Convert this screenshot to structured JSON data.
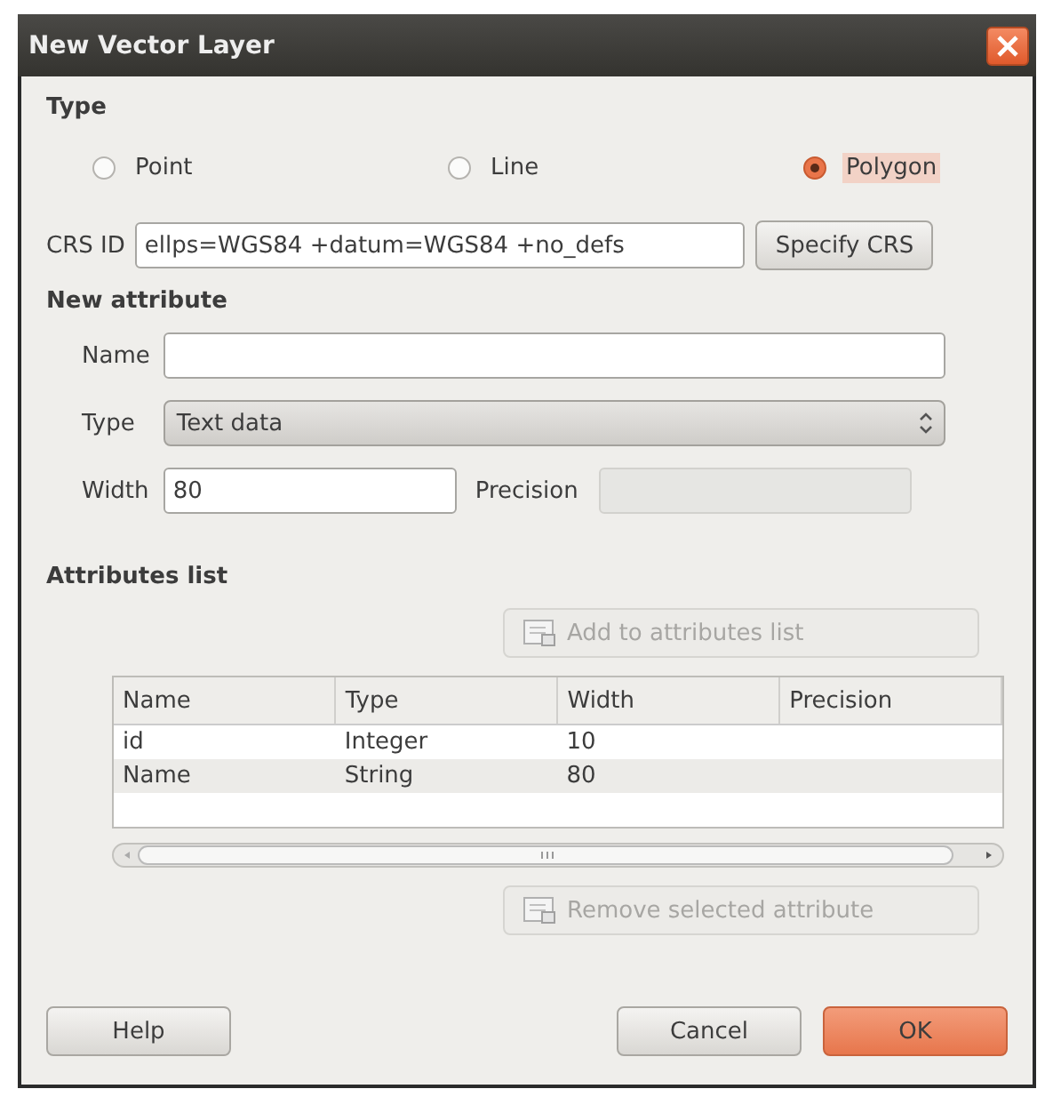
{
  "window": {
    "title": "New Vector Layer"
  },
  "type_section": {
    "heading": "Type",
    "options": [
      {
        "label": "Point",
        "selected": false
      },
      {
        "label": "Line",
        "selected": false
      },
      {
        "label": "Polygon",
        "selected": true
      }
    ]
  },
  "crs": {
    "label": "CRS ID",
    "value": "ellps=WGS84 +datum=WGS84 +no_defs",
    "button": "Specify CRS"
  },
  "new_attribute": {
    "heading": "New attribute",
    "name_label": "Name",
    "type_label": "Type",
    "type_value": "Text data",
    "width_label": "Width",
    "width_value": "80",
    "precision_label": "Precision",
    "precision_disabled": true
  },
  "attributes_list": {
    "heading": "Attributes list",
    "add_button": {
      "label": "Add to attributes list",
      "disabled": true
    },
    "columns": [
      "Name",
      "Type",
      "Width",
      "Precision"
    ],
    "rows": [
      {
        "cells": [
          "id",
          "Integer",
          "10",
          ""
        ]
      },
      {
        "cells": [
          "Name",
          "String",
          "80",
          ""
        ]
      }
    ],
    "remove_button": {
      "label": "Remove selected attribute",
      "disabled": true
    }
  },
  "buttons": [
    {
      "label": "Help",
      "default": false
    },
    {
      "label": "Cancel",
      "default": false
    },
    {
      "label": "OK",
      "default": true
    }
  ]
}
